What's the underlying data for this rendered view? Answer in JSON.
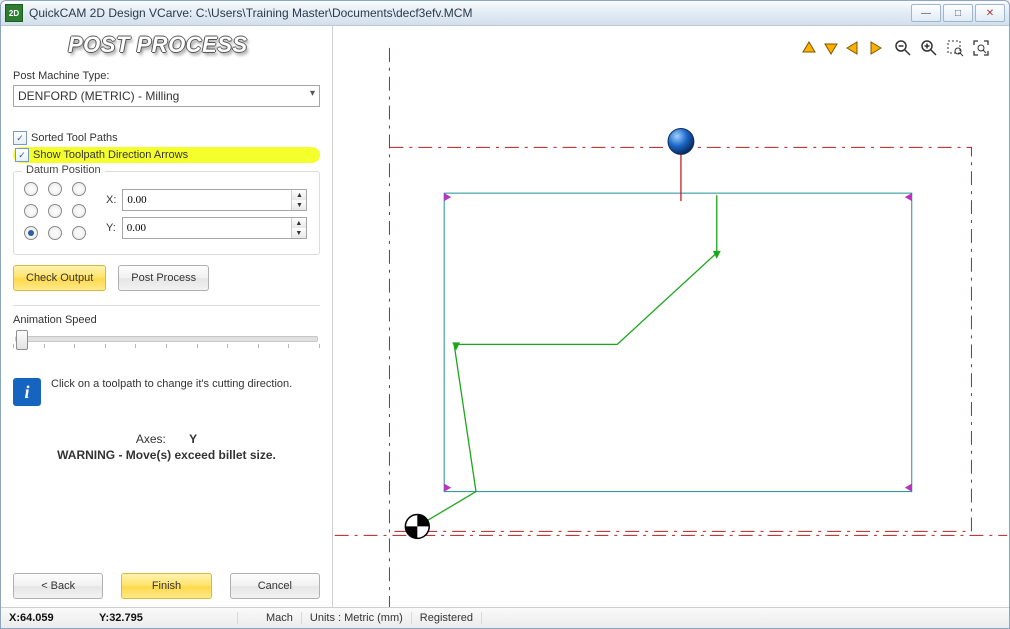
{
  "title": "QuickCAM 2D Design VCarve: C:\\Users\\Training Master\\Documents\\decf3efv.MCM",
  "app_icon_text": "2D",
  "banner": "POST PROCESS",
  "post_machine_label": "Post Machine Type:",
  "post_machine_value": "DENFORD (METRIC) - Milling",
  "sorted_label": "Sorted Tool Paths",
  "show_arrows_label": "Show Toolpath Direction Arrows",
  "datum_group": "Datum Position",
  "x_label": "X:",
  "y_label": "Y:",
  "x_value": "0.00",
  "y_value": "0.00",
  "check_output": "Check Output",
  "post_process": "Post Process",
  "anim_label": "Animation Speed",
  "info_text": "Click on a toolpath to change it's cutting direction.",
  "axes_label": "Axes:",
  "axes_value": "Y",
  "warning": "WARNING - Move(s) exceed billet size.",
  "back": "< Back",
  "finish": "Finish",
  "cancel": "Cancel",
  "status": {
    "x_lbl": "X: ",
    "x_val": "64.059",
    "y_lbl": "Y: ",
    "y_val": "32.795",
    "mach": "Mach",
    "units": "Units : Metric (mm)",
    "reg": "Registered"
  },
  "icons": {
    "up": "up-arrow",
    "down": "down-arrow",
    "left": "left-arrow",
    "right": "right-arrow",
    "zoom_out": "zoom-out",
    "zoom_in": "zoom-in",
    "zoom_sel": "zoom-selection",
    "zoom_fit": "zoom-fit"
  }
}
